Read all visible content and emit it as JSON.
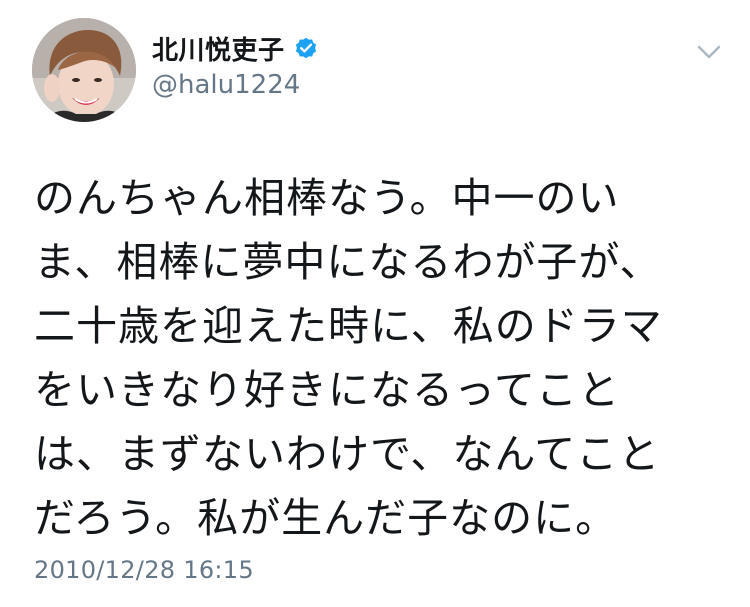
{
  "tweet": {
    "author": {
      "display_name": "北川悦吏子",
      "handle": "@halu1224",
      "verified": true
    },
    "body_lines": [
      "のんちゃん相棒なう。中一のい",
      "ま、相棒に夢中になるわが子が、",
      "二十歳を迎えた時に、私のドラマ",
      "をいきなり好きになるってこと",
      "は、まずないわけで、なんてこと",
      "だろう。私が生んだ子なのに。"
    ],
    "timestamp": "2010/12/28 16:15"
  },
  "icons": {
    "verified": "verified-badge-icon",
    "menu": "chevron-down-icon"
  },
  "colors": {
    "text": "#14171a",
    "secondary": "#657786",
    "verified_blue": "#1da1f2",
    "chevron": "#aab8c2"
  }
}
